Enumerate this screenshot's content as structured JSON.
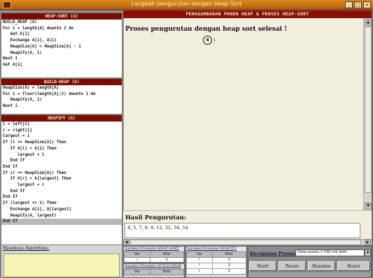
{
  "window": {
    "title": "Langkah pengurutan dengan Heap Sort",
    "controls": [
      "_",
      "□",
      "×"
    ]
  },
  "code": {
    "heap_sort": {
      "header": "HEAP-SORT (A)",
      "lines": [
        "BUILD_HEAP (A)",
        "For i = length[A] downto 2 do",
        "   Get A[1]",
        "   Exchange A[1], A[i]",
        "   HeapSize[A] = HeapSize[A] - 1",
        "   Heapify(A, 1)",
        "Next i",
        "Get A[1]"
      ]
    },
    "build_heap": {
      "header": "BUILD-HEAP (A)",
      "lines": [
        "HeapSize(A) = length[A]",
        "For i = floor(length[A]/2) downto 1 do",
        "   Heapify(A, i)",
        "Next i"
      ]
    },
    "heapify": {
      "header": "HEAPIFY (A)",
      "lines": [
        "l = left[i]",
        "r = right[i]",
        "largest = i",
        "If (l <= HeapSize[A]) Then",
        "   If A[l] > A[i] Then",
        "      largest = l",
        "   End If",
        "End If",
        "If (r <= HeapSize[A]) Then",
        "   If A[r] > A[largest] Then",
        "      largest = r",
        "   End If",
        "End If",
        "If (largest <> i) Then",
        "   Exchange A[i], A[largest]",
        "   Heapify(A, largest)",
        "End If"
      ]
    }
  },
  "eksekusi": {
    "label": "Eksekusi Algoritma:"
  },
  "main": {
    "header": "PENGGAMBARAN POHON HEAP & PROSES HEAP-SORT",
    "status": "Proses pengurutan dengan heap sort selesai !",
    "node": {
      "value": "4",
      "index": "1"
    }
  },
  "hasil": {
    "label": "Hasil Pengurutan:",
    "value": "4, 5, 7, 8, 9, 12, 32, 54, 54"
  },
  "tables": {
    "heap_sort_vars": {
      "caption": "Variabel Prosedur HEAP-SORT",
      "headers": [
        "Var",
        "Nilai"
      ],
      "rows": [
        [
          "i",
          "1"
        ]
      ]
    },
    "build_heap_vars": {
      "caption": "Variabel Prosedur BUILD-HEAP",
      "headers": [
        "Var",
        "Nilai"
      ]
    },
    "heapify_vars": {
      "caption": "Variabel Prosedur HEAPIFY",
      "headers": [
        "Var",
        "Nilai"
      ],
      "rows": [
        [
          "i",
          "1"
        ],
        [
          "l",
          "2"
        ],
        [
          "r",
          "3"
        ]
      ]
    }
  },
  "controls": {
    "speed_label": "Kecepatan Proses:",
    "speed_value": "Delay proses = 500 mili detik",
    "buttons": {
      "start": "Start",
      "pause": "Pause",
      "resume": "Resume",
      "reset": "Reset"
    }
  },
  "colors": {
    "header_bg": "#8a0e00",
    "canvas_bg": "#f2eedd",
    "titlebar": "#c8731a"
  }
}
